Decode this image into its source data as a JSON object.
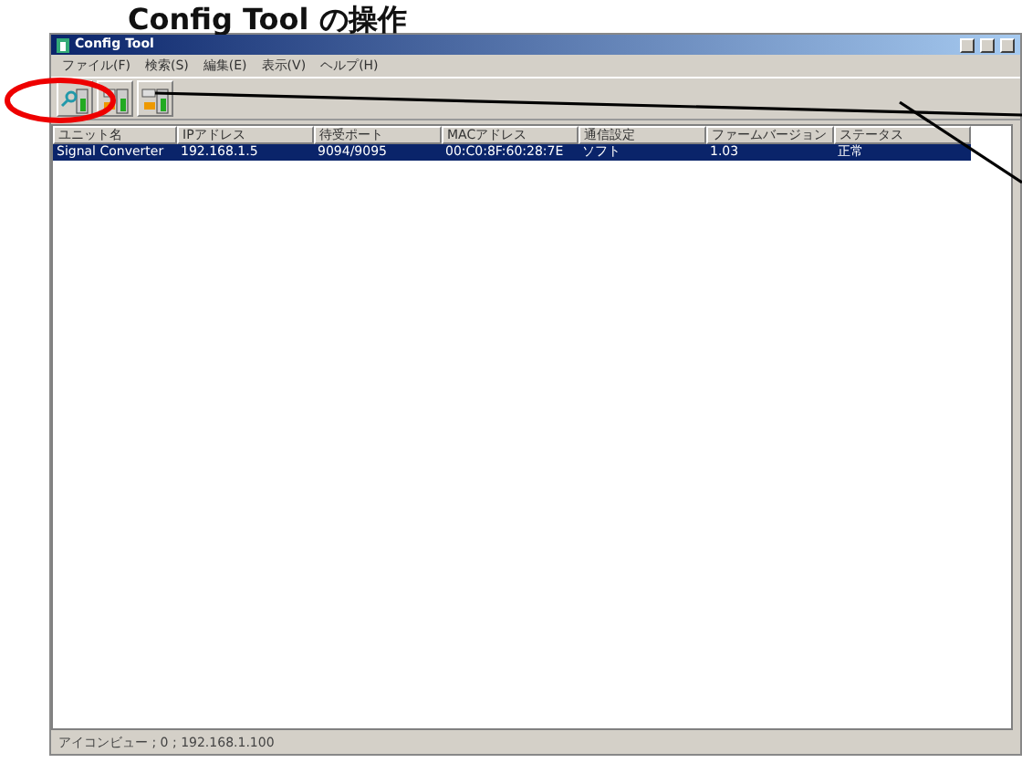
{
  "heading": "Config Tool の操作",
  "window": {
    "title": "Config Tool"
  },
  "menu": [
    "ファイル(F)",
    "検索(S)",
    "編集(E)",
    "表示(V)",
    "ヘルプ(H)"
  ],
  "toolbar": [
    {
      "kind": "search"
    },
    {
      "kind": "ip"
    },
    {
      "kind": "com"
    }
  ],
  "table": {
    "columns": [
      "ユニット名",
      "IPアドレス",
      "待受ポート",
      "MACアドレス",
      "通信設定",
      "ファームバージョン",
      "ステータス"
    ],
    "rows": [
      {
        "selected": true,
        "cells": [
          "Signal Converter",
          "192.168.1.5",
          "9094/9095",
          "00:C0:8F:60:28:7E",
          "ソフト",
          "1.03",
          "正常"
        ]
      }
    ]
  },
  "status_bar": "アイコンビュー ; 0 ; 192.168.1.100"
}
